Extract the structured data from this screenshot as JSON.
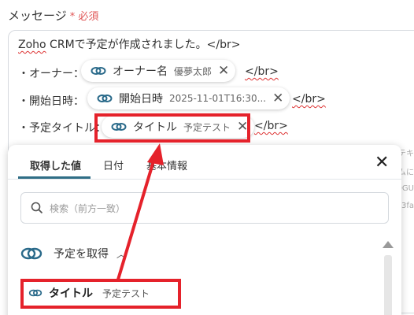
{
  "field": {
    "label": "メッセージ",
    "required": "必須"
  },
  "editor": {
    "line1": "Zoho CRMで予定が作成されました。</br>",
    "line1_parts": {
      "zoho": "Zoho",
      "rest": " CRMで予定が作成されました。",
      "tag": "</br>"
    },
    "owner": {
      "prefix": "・オーナー：",
      "chip_name": "オーナー名",
      "chip_value": "優夢太郎",
      "suffix": "</br>"
    },
    "start": {
      "prefix": "・開始日時：",
      "chip_name": "開始日時",
      "chip_value": "2025-11-01T16:30...",
      "suffix": "</br>"
    },
    "title": {
      "prefix": "・予定タイトル：",
      "chip_name": "タイトル",
      "chip_value": "予定テスト",
      "suffix": "</br>"
    }
  },
  "side_fragments": [
    "テキ",
    "ムに",
    "OGU",
    "3fa"
  ],
  "panel": {
    "tabs": [
      "取得した値",
      "日付",
      "基本情報"
    ],
    "active_tab": "取得した値",
    "search_placeholder": "検索（前方一致）",
    "section_label": "予定を取得",
    "item": {
      "name": "タイトル",
      "value": "予定テスト"
    }
  },
  "icons": [
    "zoho-link-icon",
    "close-icon",
    "search-icon",
    "caret-up-icon",
    "scroll-up-icon"
  ],
  "colors": {
    "highlight": "#e5222b",
    "accent": "#2f6e86",
    "required": "#e05656",
    "zoho_icon": "#2a6a8a"
  }
}
